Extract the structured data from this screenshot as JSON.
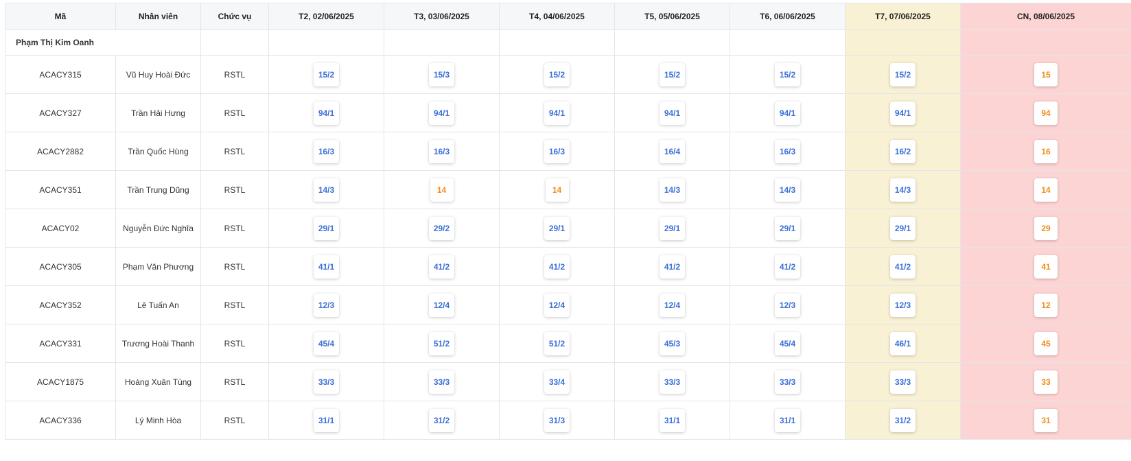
{
  "colors": {
    "shift_text": "#3b6fd8",
    "off_text": "#f08c1a",
    "saturday_bg": "#f8f1d4",
    "sunday_bg": "#fdd4d4"
  },
  "headers": {
    "code": "Mã",
    "employee": "Nhân viên",
    "position": "Chức vụ",
    "days": [
      "T2, 02/06/2025",
      "T3, 03/06/2025",
      "T4, 04/06/2025",
      "T5, 05/06/2025",
      "T6, 06/06/2025",
      "T7, 07/06/2025",
      "CN, 08/06/2025"
    ]
  },
  "group": {
    "name": "Phạm Thị Kim Oanh"
  },
  "rows": [
    {
      "code": "ACACY315",
      "name": "Vũ Huy Hoài Đức",
      "position": "RSTL",
      "shifts": [
        "15/2",
        "15/3",
        "15/2",
        "15/2",
        "15/2",
        "15/2",
        "15"
      ]
    },
    {
      "code": "ACACY327",
      "name": "Trần Hải Hưng",
      "position": "RSTL",
      "shifts": [
        "94/1",
        "94/1",
        "94/1",
        "94/1",
        "94/1",
        "94/1",
        "94"
      ]
    },
    {
      "code": "ACACY2882",
      "name": "Trần Quốc Hùng",
      "position": "RSTL",
      "shifts": [
        "16/3",
        "16/3",
        "16/3",
        "16/4",
        "16/3",
        "16/2",
        "16"
      ]
    },
    {
      "code": "ACACY351",
      "name": "Trần Trung Dũng",
      "position": "RSTL",
      "shifts": [
        "14/3",
        "14",
        "14",
        "14/3",
        "14/3",
        "14/3",
        "14"
      ]
    },
    {
      "code": "ACACY02",
      "name": "Nguyễn Đức Nghĩa",
      "position": "RSTL",
      "shifts": [
        "29/1",
        "29/2",
        "29/1",
        "29/1",
        "29/1",
        "29/1",
        "29"
      ]
    },
    {
      "code": "ACACY305",
      "name": "Phạm Văn Phương",
      "position": "RSTL",
      "shifts": [
        "41/1",
        "41/2",
        "41/2",
        "41/2",
        "41/2",
        "41/2",
        "41"
      ]
    },
    {
      "code": "ACACY352",
      "name": "Lê Tuấn An",
      "position": "RSTL",
      "shifts": [
        "12/3",
        "12/4",
        "12/4",
        "12/4",
        "12/3",
        "12/3",
        "12"
      ]
    },
    {
      "code": "ACACY331",
      "name": "Trương Hoài Thanh",
      "position": "RSTL",
      "shifts": [
        "45/4",
        "51/2",
        "51/2",
        "45/3",
        "45/4",
        "46/1",
        "45"
      ]
    },
    {
      "code": "ACACY1875",
      "name": "Hoàng Xuân Tùng",
      "position": "RSTL",
      "shifts": [
        "33/3",
        "33/3",
        "33/4",
        "33/3",
        "33/3",
        "33/3",
        "33"
      ]
    },
    {
      "code": "ACACY336",
      "name": "Lý Minh Hòa",
      "position": "RSTL",
      "shifts": [
        "31/1",
        "31/2",
        "31/3",
        "31/1",
        "31/1",
        "31/2",
        "31"
      ]
    }
  ]
}
